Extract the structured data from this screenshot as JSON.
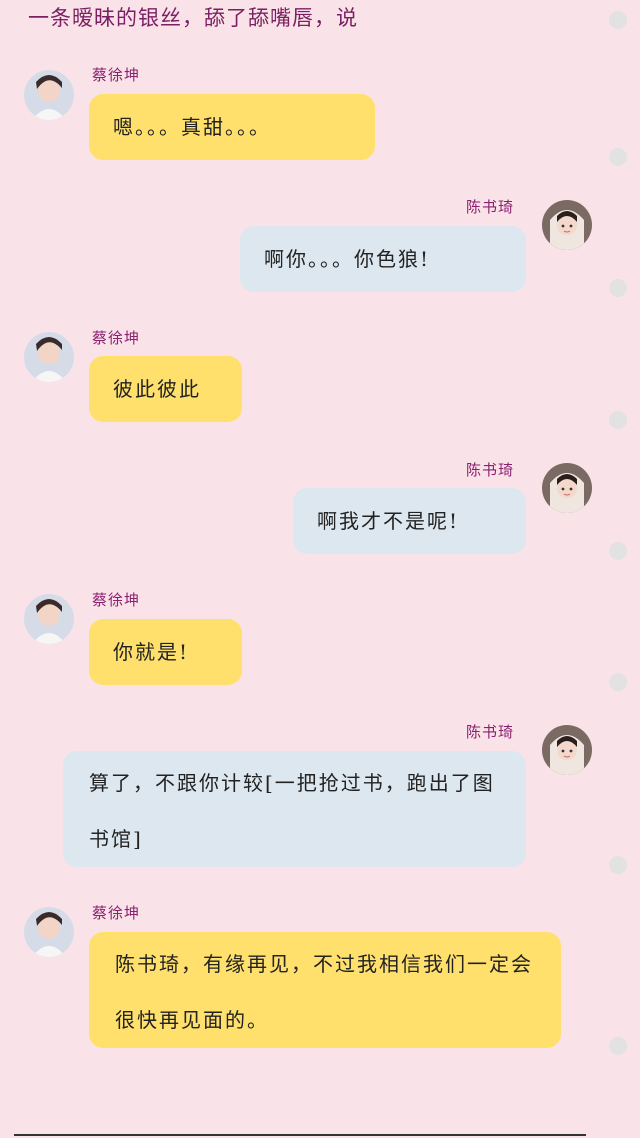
{
  "narration": "一条暧昧的银丝，舔了舔嘴唇，说",
  "messages": [
    {
      "sender": "蔡徐坤",
      "side": "left",
      "text": "嗯。。。真甜。。。"
    },
    {
      "sender": "陈书琦",
      "side": "right",
      "text": "啊你。。。你色狼!"
    },
    {
      "sender": "蔡徐坤",
      "side": "left",
      "text": "彼此彼此"
    },
    {
      "sender": "陈书琦",
      "side": "right",
      "text": "啊我才不是呢!"
    },
    {
      "sender": "蔡徐坤",
      "side": "left",
      "text": "你就是!"
    },
    {
      "sender": "陈书琦",
      "side": "right",
      "text": "算了，不跟你计较[一把抢过书，跑出了图书馆]"
    },
    {
      "sender": "蔡徐坤",
      "side": "left",
      "text": "陈书琦，有缘再见，不过我相信我们一定会很快再见面的。"
    }
  ],
  "colors": {
    "background": "#fae3e8",
    "left_bubble": "#ffe06d",
    "right_bubble": "#dde7ef",
    "name": "#8a2070"
  },
  "icons": {
    "left_avatar": "male-avatar",
    "right_avatar": "female-avatar",
    "rail": "scroll-dot"
  }
}
